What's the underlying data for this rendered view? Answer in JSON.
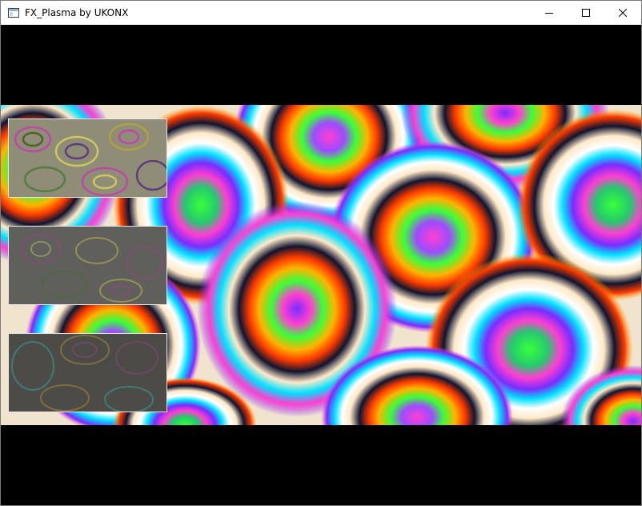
{
  "window": {
    "title": "FX_Plasma by UKONX",
    "controls": {
      "minimize_icon": "minimize-icon",
      "maximize_icon": "maximize-icon",
      "close_icon": "close-icon"
    }
  },
  "canvas": {
    "background": "#000000",
    "plasma_palette": [
      "#ff3fd0",
      "#7a2cff",
      "#00e0ff",
      "#ffffff",
      "#ffe9c8",
      "#10142f",
      "#ff3a00",
      "#ffb300",
      "#39ff3a",
      "#25c96e"
    ],
    "previews": [
      {
        "name": "preview-1",
        "tint": "#8a8a7a"
      },
      {
        "name": "preview-2",
        "tint": "#5e5e5e"
      },
      {
        "name": "preview-3",
        "tint": "#4a4a4a"
      }
    ]
  }
}
